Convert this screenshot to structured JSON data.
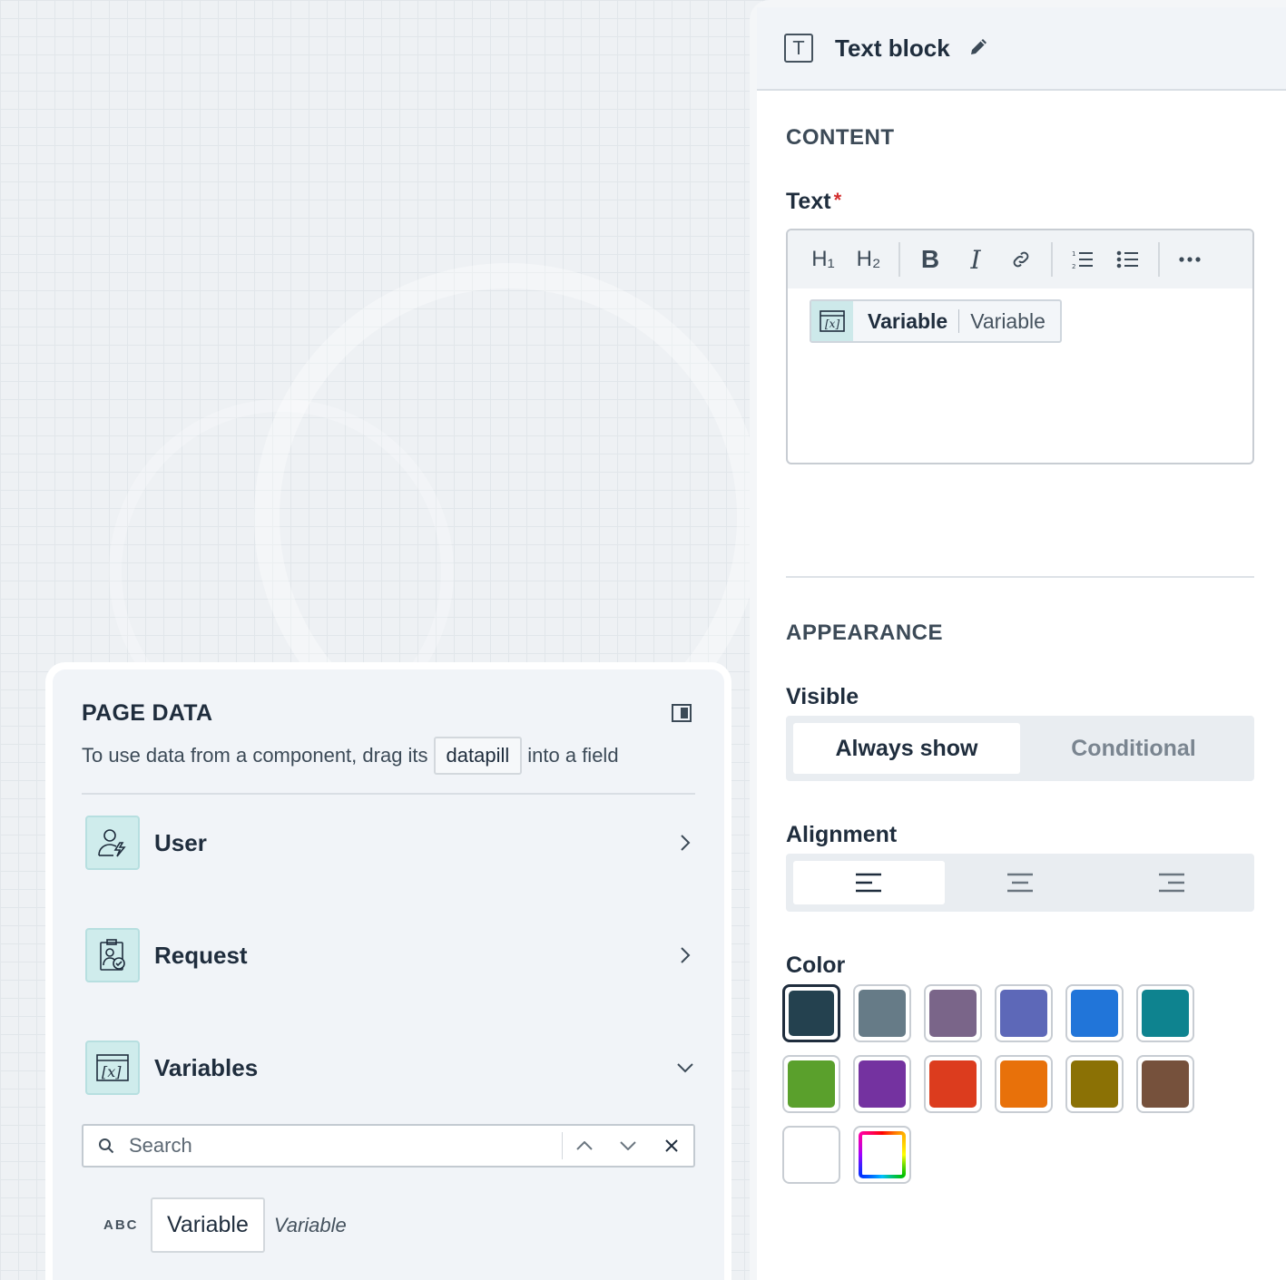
{
  "panel": {
    "title": "Text block",
    "content_heading": "CONTENT",
    "text_label": "Text",
    "required_mark": "*",
    "editor": {
      "toolbar": [
        "H₁",
        "H₂",
        "B",
        "I",
        "link-icon",
        "ordered-list-icon",
        "bullet-list-icon",
        "more-icon"
      ],
      "pill_name": "Variable",
      "pill_type": "Variable"
    },
    "appearance_heading": "APPEARANCE",
    "visible_label": "Visible",
    "visible_options": [
      "Always show",
      "Conditional"
    ],
    "visible_selected": "Always show",
    "alignment_label": "Alignment",
    "alignment_options": [
      "align-left-icon",
      "align-center-icon",
      "align-right-icon"
    ],
    "alignment_selected": "align-left-icon",
    "color_label": "Color",
    "colors": [
      "#24414f",
      "#667b87",
      "#7a6589",
      "#5d68b8",
      "#2175d9",
      "#0e838f",
      "#5aa02c",
      "#7432a0",
      "#dc3c1e",
      "#e8710a",
      "#8b7105",
      "#76513c",
      "#ffffff",
      "custom-gradient"
    ],
    "color_selected": "#24414f"
  },
  "page_data": {
    "title": "PAGE DATA",
    "desc_before": "To use data from a component, drag its",
    "desc_chip": "datapill",
    "desc_after": "into a field",
    "sections": [
      {
        "label": "User",
        "icon": "user-icon",
        "state": "collapsed"
      },
      {
        "label": "Request",
        "icon": "request-icon",
        "state": "collapsed"
      },
      {
        "label": "Variables",
        "icon": "variable-icon",
        "state": "expanded"
      }
    ],
    "search_placeholder": "Search",
    "variable": {
      "type_badge": "ABC",
      "name": "Variable",
      "type": "Variable"
    }
  }
}
